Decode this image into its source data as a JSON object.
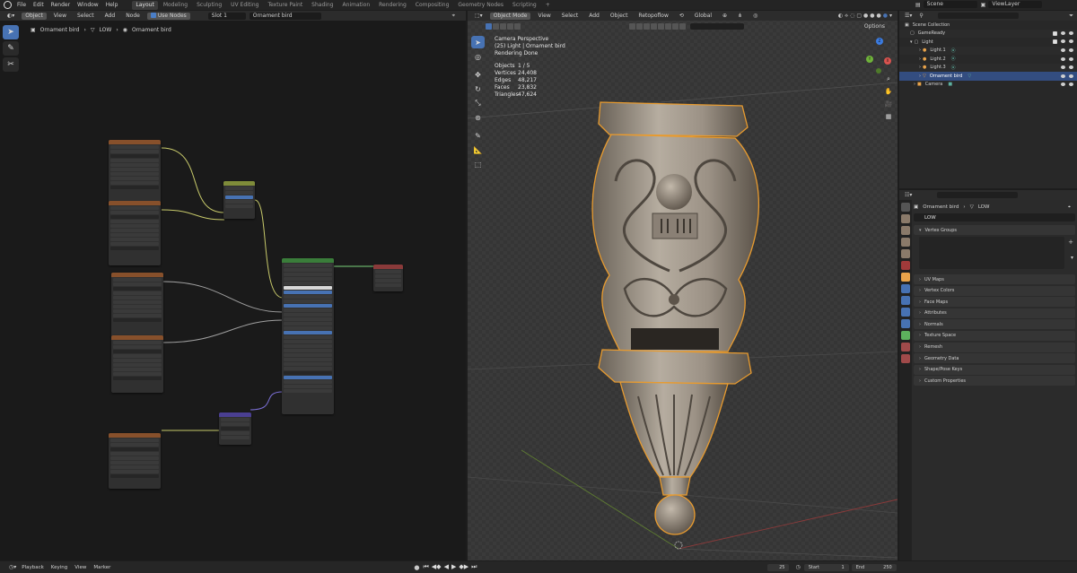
{
  "topbar": {
    "menus": [
      "File",
      "Edit",
      "Render",
      "Window",
      "Help"
    ],
    "workspaces": [
      "Layout",
      "Modeling",
      "Sculpting",
      "UV Editing",
      "Texture Paint",
      "Shading",
      "Animation",
      "Rendering",
      "Compositing",
      "Geometry Nodes",
      "Scripting"
    ],
    "active_workspace": "Layout",
    "scene": "Scene",
    "view_layer": "ViewLayer"
  },
  "node_editor": {
    "object_type": "Object",
    "menus": [
      "View",
      "Select",
      "Add",
      "Node"
    ],
    "use_nodes_label": "Use Nodes",
    "slot": "Slot 1",
    "material": "Ornament bird",
    "breadcrumb": [
      "Ornament bird",
      "LOW",
      "Ornament bird"
    ]
  },
  "viewport": {
    "mode": "Object Mode",
    "menus": [
      "View",
      "Select",
      "Add",
      "Object"
    ],
    "topology": "Retopoflow",
    "orientation": "Global",
    "options_label": "Options",
    "info": {
      "view": "Camera Perspective",
      "context": "(25) Light | Ornament bird",
      "status": "Rendering Done"
    },
    "stats": [
      {
        "label": "Objects",
        "value": "1 / 5"
      },
      {
        "label": "Vertices",
        "value": "24,408"
      },
      {
        "label": "Edges",
        "value": "48,217"
      },
      {
        "label": "Faces",
        "value": "23,832"
      },
      {
        "label": "Triangles",
        "value": "47,624"
      }
    ],
    "gizmo": {
      "x": "X",
      "y": "Y",
      "z": "Z"
    }
  },
  "outliner": {
    "title": "Scene Collection",
    "rows": [
      {
        "name": "GameReady",
        "indent": 1,
        "color": "#e0e0e0"
      },
      {
        "name": "Light",
        "indent": 1,
        "color": "#e0e0e0"
      },
      {
        "name": "Light.1",
        "indent": 2,
        "color": "#e8a34a"
      },
      {
        "name": "Light.2",
        "indent": 2,
        "color": "#e8a34a"
      },
      {
        "name": "Light.3",
        "indent": 2,
        "color": "#e8a34a"
      },
      {
        "name": "Ornament bird",
        "indent": 2,
        "color": "#e8a34a"
      },
      {
        "name": "Camera",
        "indent": 1,
        "color": "#e8a34a"
      }
    ],
    "selected_index": 5
  },
  "properties": {
    "breadcrumb": [
      "Ornament bird",
      "LOW"
    ],
    "mesh_name": "LOW",
    "vertex_groups_label": "Vertex Groups",
    "panels": [
      "UV Maps",
      "Vertex Colors",
      "Face Maps",
      "Attributes",
      "Normals",
      "Texture Space",
      "Remesh",
      "Geometry Data",
      "Shape/Pose Keys",
      "Custom Properties"
    ]
  },
  "timeline": {
    "menus": [
      "Playback",
      "Keying",
      "View",
      "Marker"
    ],
    "current_frame": "25",
    "start_label": "Start",
    "start": "1",
    "end_label": "End",
    "end": "250"
  },
  "colors": {
    "accent": "#4772b3",
    "selection": "#e89b2f",
    "texture_node_header": "#87502b",
    "mix_node_header": "#7f8c3a",
    "bsdf_node_header": "#3a7d3a",
    "output_node_header": "#8a3a3a",
    "normal_node_header": "#4a3f91"
  }
}
